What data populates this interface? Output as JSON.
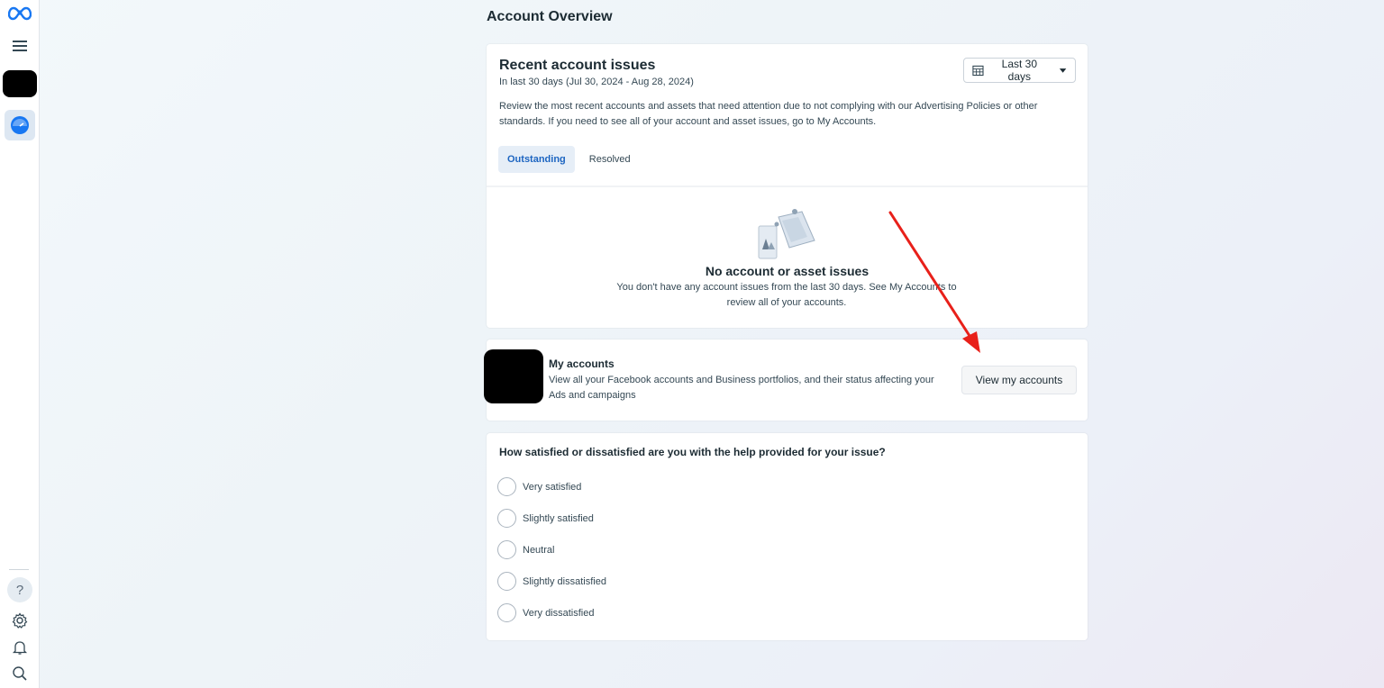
{
  "page": {
    "title": "Account Overview"
  },
  "sidebar": {
    "icons": [
      "meta-logo-icon",
      "hamburger-menu-icon",
      "dashboard-icon",
      "help-icon",
      "gear-icon",
      "bell-icon",
      "search-icon"
    ],
    "help_glyph": "?"
  },
  "issues": {
    "title": "Recent account issues",
    "subtitle": "In last 30 days (Jul 30, 2024 - Aug 28, 2024)",
    "date_range_label": "Last 30 days",
    "description": "Review the most recent accounts and assets that need attention due to not complying with our Advertising Policies or other standards. If you need to see all of your account and asset issues, go to My Accounts.",
    "tabs": [
      {
        "label": "Outstanding",
        "active": true
      },
      {
        "label": "Resolved",
        "active": false
      }
    ],
    "empty_title": "No account or asset issues",
    "empty_text": "You don't have any account issues from the last 30 days. See My Accounts to review all of your accounts."
  },
  "my_accounts": {
    "title": "My accounts",
    "description": "View all your Facebook accounts and Business portfolios, and their status affecting your Ads and campaigns",
    "button_label": "View my accounts"
  },
  "survey": {
    "question": "How satisfied or dissatisfied are you with the help provided for your issue?",
    "options": [
      "Very satisfied",
      "Slightly satisfied",
      "Neutral",
      "Slightly dissatisfied",
      "Very dissatisfied"
    ]
  },
  "colors": {
    "accent": "#1d65c1",
    "annotation_arrow": "#e8201a",
    "text_primary": "#1c2b33"
  }
}
